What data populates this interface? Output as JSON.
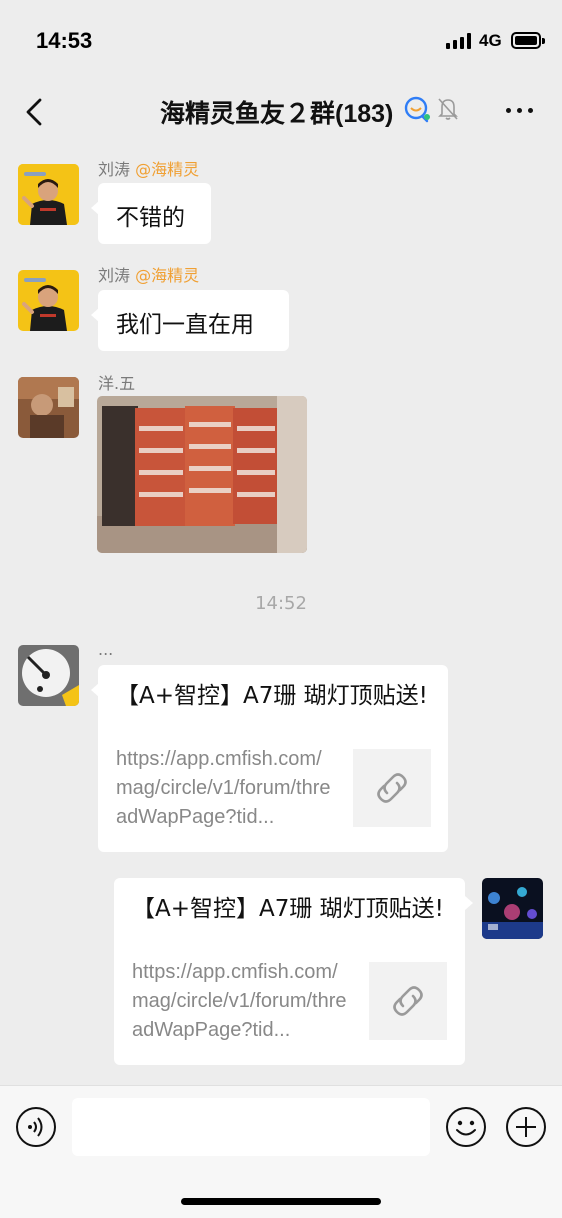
{
  "status_bar": {
    "time": "14:53",
    "network": "4G",
    "icons": [
      "signal-bars-icon",
      "battery-icon"
    ]
  },
  "header": {
    "title": "海精灵鱼友２群(183)",
    "icons": [
      "back-chevron-icon",
      "qq-chat-icon",
      "muted-bell-icon",
      "more-dots-icon"
    ]
  },
  "messages": [
    {
      "side": "left",
      "sender": "刘涛",
      "mention": "@海精灵",
      "type": "text",
      "text": "不错的",
      "avatar": "person-avatar"
    },
    {
      "side": "left",
      "sender": "刘涛",
      "mention": "@海精灵",
      "type": "text",
      "text": "我们一直在用",
      "avatar": "person-avatar"
    },
    {
      "side": "left",
      "sender": "洋.五",
      "type": "image",
      "image": "stacked-product-bags-photo",
      "avatar": "photo-avatar"
    },
    {
      "type": "time",
      "text": "14:52"
    },
    {
      "side": "left",
      "sender": "...",
      "type": "link",
      "title": "【A+智控】A7珊 瑚灯顶贴送!",
      "url": "https://app.cmfish.com/mag/circle/v1/forum/threadWapPage?tid...",
      "thumb_icon": "link-icon",
      "avatar": "clock-avatar"
    },
    {
      "side": "right",
      "type": "link",
      "title": "【A+智控】A7珊 瑚灯顶贴送!",
      "url": "https://app.cmfish.com/mag/circle/v1/forum/threadWapPage?tid...",
      "thumb_icon": "link-icon",
      "avatar": "aquarium-avatar"
    }
  ],
  "input_bar": {
    "text_value": "",
    "icons": [
      "voice-icon",
      "emoji-icon",
      "plus-icon"
    ]
  },
  "colors": {
    "background": "#ededed",
    "bubble": "#ffffff",
    "mention": "#f0a033",
    "meta_text": "#7a7a7a"
  }
}
